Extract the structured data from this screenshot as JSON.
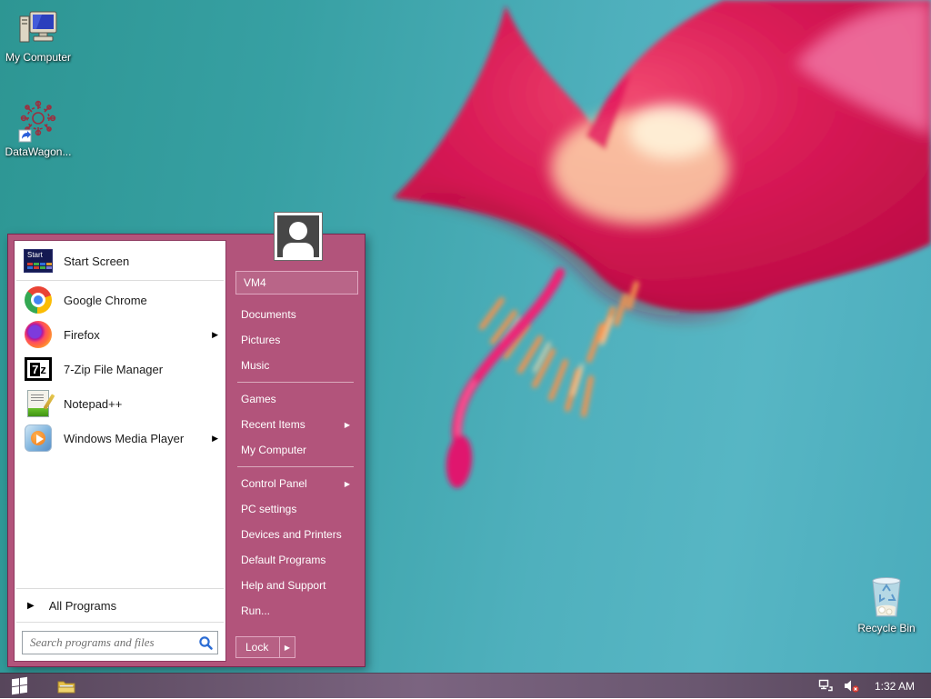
{
  "desktop": {
    "icons": [
      {
        "label": "My Computer"
      },
      {
        "label": "DataWagon..."
      },
      {
        "label": "Recycle Bin"
      }
    ]
  },
  "start_menu": {
    "user_name": "VM4",
    "left_items": [
      {
        "label": "Start Screen",
        "has_submenu": false
      },
      {
        "label": "Google Chrome",
        "has_submenu": false
      },
      {
        "label": "Firefox",
        "has_submenu": true
      },
      {
        "label": "7-Zip File Manager",
        "has_submenu": false
      },
      {
        "label": "Notepad++",
        "has_submenu": false
      },
      {
        "label": "Windows Media Player",
        "has_submenu": true
      }
    ],
    "all_programs_label": "All Programs",
    "search_placeholder": "Search programs and files",
    "right_items": [
      {
        "label": "Documents",
        "has_submenu": false
      },
      {
        "label": "Pictures",
        "has_submenu": false
      },
      {
        "label": "Music",
        "has_submenu": false
      },
      {
        "label": "Games",
        "has_submenu": false
      },
      {
        "label": "Recent Items",
        "has_submenu": true
      },
      {
        "label": "My Computer",
        "has_submenu": false
      },
      {
        "label": "Control Panel",
        "has_submenu": true
      },
      {
        "label": "PC settings",
        "has_submenu": false
      },
      {
        "label": "Devices and Printers",
        "has_submenu": false
      },
      {
        "label": "Default Programs",
        "has_submenu": false
      },
      {
        "label": "Help and Support",
        "has_submenu": false
      },
      {
        "label": "Run...",
        "has_submenu": false
      }
    ],
    "lock_label": "Lock",
    "submenu_arrow": "▶",
    "all_programs_arrow": "▶"
  },
  "taskbar": {
    "time": "1:32 AM"
  },
  "icons": {
    "start_button": "windows-logo-icon",
    "explorer": "file-explorer-folder-icon",
    "network": "network-status-icon",
    "volume": "volume-muted-icon",
    "search": "search-magnifier-icon",
    "user": "user-avatar-silhouette"
  },
  "colors": {
    "menu_panel": "#b2547b",
    "menu_border": "#76264e",
    "menu_highlight_border": "#e0a6c0",
    "taskbar": "#6a5770",
    "desktop_teal": "#3aa2a8",
    "flower_crimson": "#d91b56",
    "flower_stigma": "#ee2076",
    "search_icon_blue": "#2b6cd4"
  }
}
